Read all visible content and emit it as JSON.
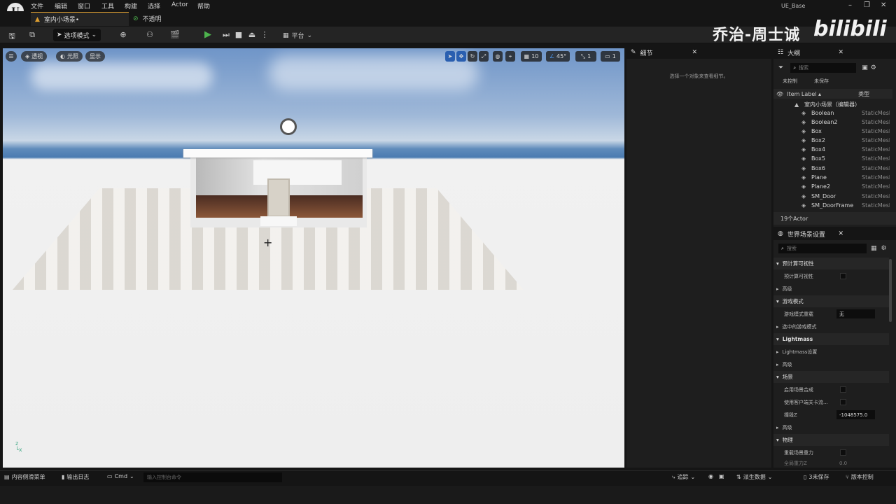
{
  "menu": {
    "items": [
      "文件",
      "编辑",
      "窗口",
      "工具",
      "构建",
      "选择",
      "Actor",
      "帮助"
    ]
  },
  "window": {
    "title": "UE_Base",
    "level_tab": "室内小场景•",
    "opacity_tab": "不透明"
  },
  "toolbar": {
    "mode_label": "选项模式",
    "platform_label": "平台"
  },
  "watermark": {
    "name": "乔治-周士诚",
    "site": "bilibili"
  },
  "viewport": {
    "perspective": "透视",
    "lit": "光照",
    "show": "显示",
    "grid_size": "10",
    "angle": "45°",
    "scale": "1",
    "camera_speed": "1"
  },
  "details": {
    "tab": "细节",
    "empty_msg": "选择一个对象来查看细节。"
  },
  "outliner": {
    "tab": "大纲",
    "search_placeholder": "搜索",
    "filter1": "未控制",
    "filter2": "未保存",
    "col_label": "Item Label ▴",
    "col_type": "类型",
    "root": "室内小场景（编辑器）",
    "items": [
      {
        "label": "Boolean",
        "type": "StaticMesh"
      },
      {
        "label": "Boolean2",
        "type": "StaticMesh"
      },
      {
        "label": "Box",
        "type": "StaticMesh"
      },
      {
        "label": "Box2",
        "type": "StaticMesh"
      },
      {
        "label": "Box4",
        "type": "StaticMesh"
      },
      {
        "label": "Box5",
        "type": "StaticMesh"
      },
      {
        "label": "Box6",
        "type": "StaticMesh"
      },
      {
        "label": "Plane",
        "type": "StaticMesh"
      },
      {
        "label": "Plane2",
        "type": "StaticMesh"
      },
      {
        "label": "SM_Door",
        "type": "StaticMesh"
      },
      {
        "label": "SM_DoorFrame",
        "type": "StaticMesh"
      }
    ],
    "count": "19个Actor"
  },
  "world": {
    "tab": "世界场景设置",
    "search_placeholder": "搜索",
    "c_precomputed": "预计算可视性",
    "p_precomputed": "预计算可视性",
    "c_advanced1": "高级",
    "c_gamemode": "游戏模式",
    "p_gamemode_override": "游戏模式重载",
    "v_gamemode_override": "无",
    "c_selected_gamemode": "选中的游戏模式",
    "c_lightmass": "Lightmass",
    "c_lightmass_settings": "Lightmass设置",
    "c_advanced2": "高级",
    "c_world": "场景",
    "p_enable_compose": "启用场景合成",
    "p_client_nav": "使用客户端关卡流...",
    "p_killz": "撞毁Z",
    "v_killz": "-1048575.0",
    "c_advanced3": "高级",
    "c_physics": "物理",
    "p_override_gravity": "重载场景重力",
    "p_global_gravity": "全局重力Z",
    "v_global_gravity": "0.0"
  },
  "status": {
    "content_drawer": "内容侧滑菜单",
    "output_log": "输出日志",
    "cmd": "Cmd",
    "cmd_placeholder": "输入控制台命令",
    "trace": "追踪",
    "derived_data": "派生数据",
    "unsaved": "3未保存",
    "source_control": "版本控制"
  }
}
